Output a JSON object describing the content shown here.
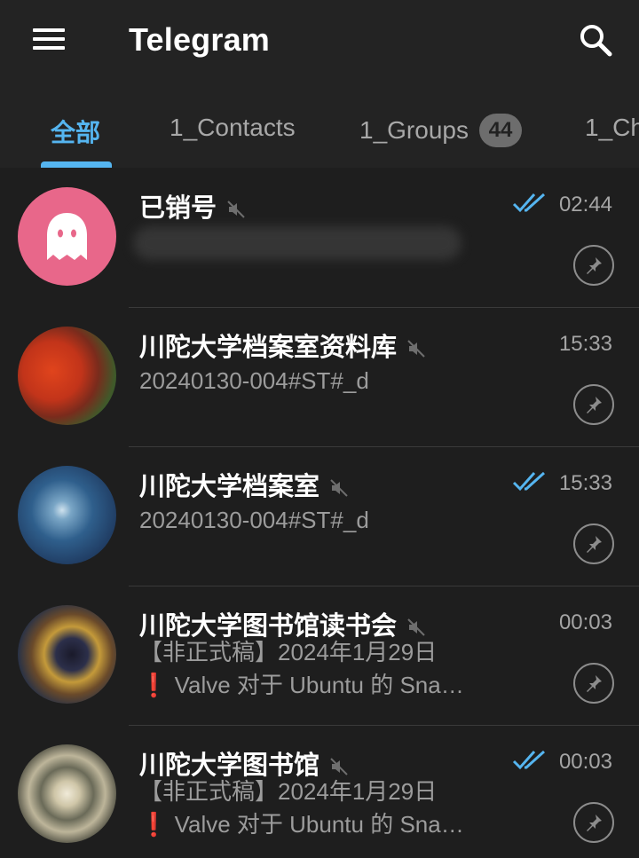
{
  "app": {
    "title": "Telegram"
  },
  "tabs": [
    {
      "label": "全部",
      "active": true
    },
    {
      "label": "1_Contacts"
    },
    {
      "label": "1_Groups",
      "badge": "44"
    },
    {
      "label": "1_Ch"
    }
  ],
  "chats": [
    {
      "name": "已销号",
      "muted": true,
      "read": true,
      "time": "02:44",
      "preview": [],
      "pinned": true
    },
    {
      "name": "川陀大学档案室资料库",
      "muted": true,
      "read": false,
      "time": "15:33",
      "preview": [
        "20240130-004#ST#_d"
      ],
      "pinned": true
    },
    {
      "name": "川陀大学档案室",
      "muted": true,
      "read": true,
      "time": "15:33",
      "preview": [
        "20240130-004#ST#_d"
      ],
      "pinned": true
    },
    {
      "name": "川陀大学图书馆读书会",
      "muted": true,
      "read": false,
      "time": "00:03",
      "preview": [
        "【非正式稿】2024年1月29日",
        "❗ Valve 对于 Ubuntu 的 Sna…"
      ],
      "pinned": true
    },
    {
      "name": "川陀大学图书馆",
      "muted": true,
      "read": true,
      "time": "00:03",
      "preview": [
        "【非正式稿】2024年1月29日",
        "❗ Valve 对于 Ubuntu 的 Sna…"
      ],
      "pinned": true
    }
  ],
  "colors": {
    "accent": "#55b5f0",
    "background": "#1e1e1e",
    "bar": "#232323",
    "ghost_avatar": "#e8678a"
  },
  "icons": {
    "menu": "hamburger-menu-icon",
    "search": "search-icon",
    "mute": "mute-icon",
    "read": "double-check-icon",
    "pin": "pin-icon"
  }
}
